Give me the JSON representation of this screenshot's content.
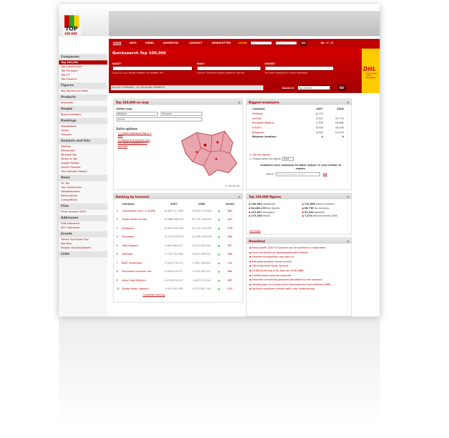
{
  "logo": {
    "text": "TOP",
    "sub": "100.000"
  },
  "nav": {
    "items": [
      "HOME",
      "INFO",
      "IMDEL",
      "ADVERTISE",
      "CONTACT",
      "NEWSLETTER",
      "LOGIN"
    ],
    "login_placeholder": "Login",
    "password_placeholder": "Password",
    "go": "GO",
    "lang": "NL / F / E"
  },
  "quicksearch": {
    "title": "Quicksearch Top 100,000",
    "what_label": "WHAT?",
    "who_label": "WHO?",
    "where_label": "WHERE?",
    "what_hint": "Company name, BRAND NUMBER, VAT NUMBER, ETC.",
    "who_hint": "ACTIVITY, KEYWORD, BRAND, PRODUCT, SECTOR",
    "where_hint": "ZIP CODE, MUNICIPALITY, SELECT PROVINCE",
    "result_bar": "100,000 COMPANIES - 63,159 BOARD MEMBERS",
    "search_in_label": "Search in",
    "search_in_value": "Top 100,000",
    "go": "GO"
  },
  "ad": {
    "brand": "DHL",
    "tagline": "EXCELLENCE. SIMPLY DELIVERED."
  },
  "sidebar": {
    "sections": [
      {
        "title": "Companies",
        "items": [
          {
            "label": "Top 100,000",
            "selected": true
          },
          {
            "label": "Top Construction"
          },
          {
            "label": "Top Transport"
          },
          {
            "label": "Top ICT"
          },
          {
            "label": "Top Graphics"
          }
        ]
      },
      {
        "title": "Figures",
        "items": [
          {
            "label": "Key figures and ratios"
          }
        ]
      },
      {
        "title": "Products",
        "items": [
          {
            "label": "Keywords"
          }
        ]
      },
      {
        "title": "People",
        "items": [
          {
            "label": "Board members"
          }
        ]
      },
      {
        "title": "Rankings",
        "items": [
          {
            "label": "Alphabetical"
          },
          {
            "label": "Sector"
          },
          {
            "label": "Turnover"
          }
        ]
      },
      {
        "title": "Analysis and lists",
        "items": [
          {
            "label": "NewTop"
          },
          {
            "label": "Benchmark"
          },
          {
            "label": "Personal Top"
          },
          {
            "label": "Where in Top"
          },
          {
            "label": "Google Toolbar"
          },
          {
            "label": "Search Provider"
          },
          {
            "label": "Top Company Report"
          }
        ]
      },
      {
        "title": "News",
        "items": [
          {
            "label": "On Top"
          },
          {
            "label": "Top Construction"
          },
          {
            "label": "Establishments"
          },
          {
            "label": "Bankruptcies"
          },
          {
            "label": "Competitions"
          }
        ]
      },
      {
        "title": "Files",
        "items": [
          {
            "label": "Press releases 2009"
          }
        ]
      },
      {
        "title": "Addresses",
        "items": [
          {
            "label": "B2B addresses"
          },
          {
            "label": "B2C addresses"
          }
        ]
      },
      {
        "title": "Events",
        "items": [
          {
            "label": "Trends Top Export Day"
          },
          {
            "label": "Manifest"
          },
          {
            "label": "Belgian Building Awards"
          }
        ]
      },
      {
        "title": "Links",
        "items": []
      }
    ]
  },
  "map": {
    "title": "Top 100,000 on map",
    "refine_label": "Refine map",
    "country": "Belgium",
    "metric": "Turnover",
    "sector_placeholder": "Sector",
    "options_title": "Extra options",
    "options": [
      "Create a personal Top in 1 step",
      "Upload and analyse your file, select prospects in 3 minutes"
    ],
    "credit": "(c) Trends Top"
  },
  "employers": {
    "title": "Biggest employers",
    "headers": [
      "Company",
      "2007",
      "2006"
    ],
    "rows": [
      [
        "Delhaize",
        "8,773",
        ""
      ],
      [
        "De Post",
        "2,901",
        "33,779"
      ],
      [
        "Randstad Belgium",
        "1,328",
        "16,980"
      ],
      [
        "N.M.B.S.",
        "8,928",
        "18,438"
      ],
      [
        "Belgacom",
        "8,928",
        "13,476"
      ]
    ],
    "median_label": "Belgium (median)",
    "median_values": [
      "4",
      "4"
    ],
    "link1": "1. Get key figures",
    "link2": "2. Choose other key figure:",
    "link2_value": "Staff",
    "compare_title": "Compare your company to other player in your sector or region.",
    "compare_label": "Search",
    "compare_placeholder": "Name or company number",
    "compare_go": "GO"
  },
  "turnover": {
    "title": "Ranking by turnover",
    "headers": [
      "Company",
      "2007",
      "2006",
      "Sector"
    ],
    "rows": [
      [
        "1",
        "Commission Fonc. & Cheffe",
        "25.667.117.467",
        "23.625.179.000",
        "BAF"
      ],
      [
        "2",
        "Toyota Motor Europe",
        "25.668.388.000",
        "24.775.726.000",
        "AUT"
      ],
      [
        "3",
        "Interbrew",
        "20.632.941.000",
        "22.101.120.000",
        "FUD"
      ],
      [
        "4",
        "Electrabel",
        "12.174.378.319",
        "12.265.340.493",
        "ENE"
      ],
      [
        "5",
        "Total Belgium",
        "9.593.964.917",
        "8.311.009.454",
        "PET"
      ],
      [
        "6",
        "Distrigas",
        "5.703.732.938",
        "6.991.796.933",
        "ENE"
      ],
      [
        "7",
        "BASF Antwerpen",
        "5.544.779.274",
        "5.361.764.000",
        "CHI"
      ],
      [
        "8",
        "Electrabel Customer Sol.",
        "5.528.479.227",
        "4.324.341.072",
        "ENE"
      ],
      [
        "9",
        "Inbev Food Belgium",
        "4.074.870.327",
        "4.467.172.524",
        "BFS"
      ],
      [
        "10",
        "Toyota Motor Logistics",
        "4.453.161.399",
        "4.371.061.126",
        "LOG"
      ]
    ],
    "more": "Complete ranking"
  },
  "figures": {
    "title": "Top 100,000 figures",
    "left": [
      {
        "n": "136,960",
        "t": "companies"
      },
      {
        "n": "64,282,178",
        "t": "key figures"
      },
      {
        "n": "213,897",
        "t": "managers"
      },
      {
        "n": "173,336",
        "t": "emails"
      }
    ],
    "right": [
      {
        "n": "131,865",
        "t": "phone numbers"
      },
      {
        "n": "86,750",
        "t": "fax numbers"
      },
      {
        "n": "67,430",
        "t": "websites"
      },
      {
        "n": "7,570",
        "t": "balance sheets 2008"
      }
    ],
    "link": "Sell leads"
  },
  "newsfeed": {
    "title": "Newsfeed",
    "items": [
      "Peiling geeft CD&V 6,4 procent van de stemmen in Vlaanderen",
      "Groen bij Sanitaf op regeringsgebouwen Kabest",
      "Vlaamse mengpolitiek naar pand of",
      "Ratchgberg begint nieuwe termijn",
      "CBA onderzoekt Korea Spectral",
      "ST-IBB bankt weg in de loop van 2008 (NBB)",
      "Conditionbank opnieuw volgende",
      "Financiële versnelling geplaatst gemiddeld op een wachterij",
      "'Verkiezingen' en kransen duid vereningsrecht was verklaard (NBB)",
      "Deutsche-staaloven hebben gelijk naar kinderopvang"
    ]
  }
}
